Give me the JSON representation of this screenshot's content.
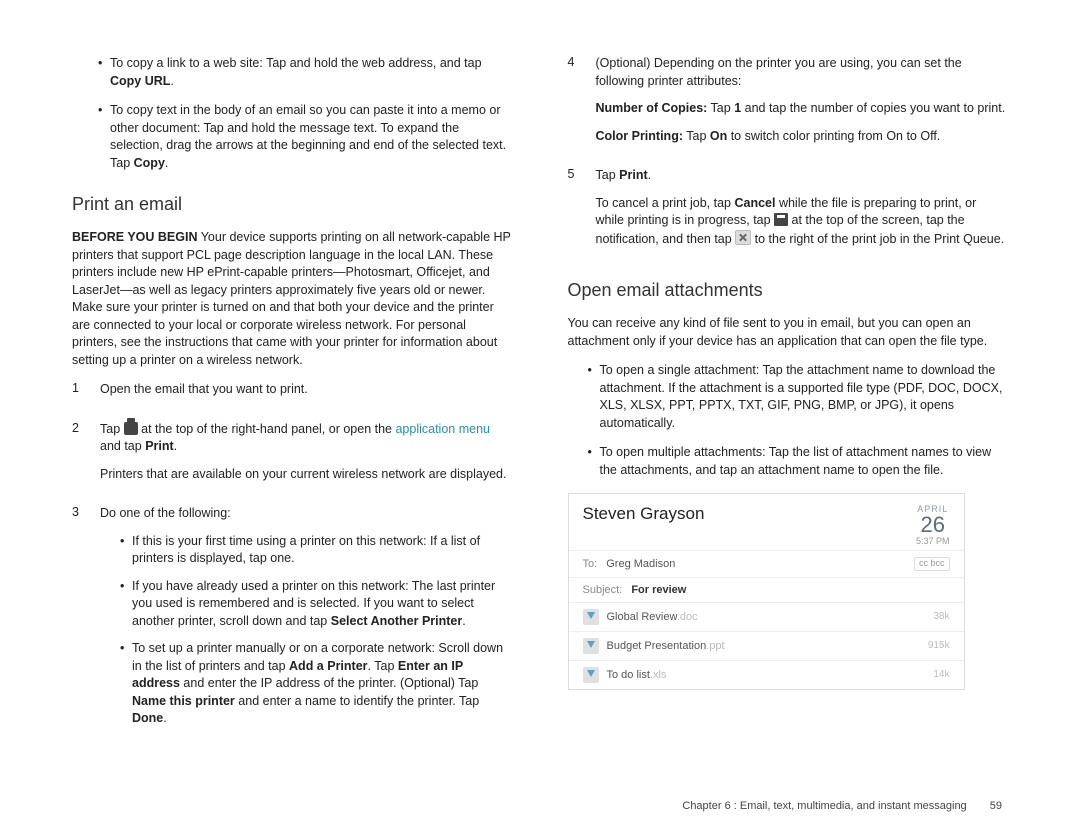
{
  "left": {
    "bullet1_a": "To copy a link to a web site: Tap and hold the web address, and tap ",
    "bullet1_b": "Copy URL",
    "bullet1_c": ".",
    "bullet2_a": "To copy text in the body of an email so you can paste it into a memo or other document: Tap and hold the message text. To expand the selection, drag the arrows at the beginning and end of the selected text. Tap ",
    "bullet2_b": "Copy",
    "bullet2_c": ".",
    "h_print": "Print an email",
    "before_label": "BEFORE YOU BEGIN",
    "before_text": "  Your device supports printing on all network-capable HP printers that support PCL page description language in the local LAN. These printers include new HP ePrint-capable printers—Photosmart, Officejet, and LaserJet—as well as legacy printers approximately five years old or newer. Make sure your printer is turned on and that both your device and the printer are connected to your local or corporate wireless network. For personal printers, see the instructions that came with your printer for information about setting up a printer on a wireless network.",
    "step1_n": "1",
    "step1": "Open the email that you want to print.",
    "step2_n": "2",
    "step2_a": "Tap ",
    "step2_b": " at the top of the right-hand panel, or open the ",
    "step2_link": "application menu",
    "step2_c": " and tap ",
    "step2_d": "Print",
    "step2_e": ".",
    "step2_note": "Printers that are available on your current wireless network are displayed.",
    "step3_n": "3",
    "step3": "Do one of the following:",
    "s3_b1": "If this is your first time using a printer on this network: If a list of printers is displayed, tap one.",
    "s3_b2_a": "If you have already used a printer on this network: The last printer you used is remembered and is selected. If you want to select another printer, scroll down and tap ",
    "s3_b2_b": "Select Another Printer",
    "s3_b2_c": ".",
    "s3_b3_a": "To set up a printer manually or on a corporate network: Scroll down in the list of printers and tap ",
    "s3_b3_b": "Add a Printer",
    "s3_b3_c": ". Tap ",
    "s3_b3_d": "Enter an IP address",
    "s3_b3_e": " and enter the IP address of the printer. (Optional) Tap ",
    "s3_b3_f": "Name this printer",
    "s3_b3_g": " and enter a name to identify the printer. Tap ",
    "s3_b3_h": "Done",
    "s3_b3_i": "."
  },
  "right": {
    "step4_n": "4",
    "step4": "(Optional) Depending on the printer you are using, you can set the following printer attributes:",
    "num_copies_a": "Number of Copies:",
    "num_copies_b": " Tap ",
    "num_copies_c": "1",
    "num_copies_d": " and tap the number of copies you want to print.",
    "color_a": "Color Printing:",
    "color_b": " Tap ",
    "color_c": "On",
    "color_d": " to switch color printing from On to Off.",
    "step5_n": "5",
    "step5_a": "Tap ",
    "step5_b": "Print",
    "step5_c": ".",
    "cancel_a": "To cancel a print job, tap ",
    "cancel_b": "Cancel",
    "cancel_c": " while the file is preparing to print, or while printing is in progress, tap ",
    "cancel_d": " at the top of the screen, tap the notification, and then tap ",
    "cancel_e": " to the right of the print job in the Print Queue.",
    "h_open": "Open email attachments",
    "open_intro": "You can receive any kind of file sent to you in email, but you can open an attachment only if your device has an application that can open the file type.",
    "ob1": "To open a single attachment: Tap the attachment name to download the attachment. If the attachment is a supported file type (PDF, DOC, DOCX, XLS, XLSX, PPT, PPTX, TXT, GIF, PNG, BMP, or JPG), it opens automatically.",
    "ob2": "To open multiple attachments: Tap the list of attachment names to view the attachments, and tap an attachment name to open the file."
  },
  "email": {
    "from": "Steven Grayson",
    "month": "APRIL",
    "day": "26",
    "time": "5:37 PM",
    "to_lbl": "To:",
    "to_val": "Greg Madison",
    "cc": "cc bcc",
    "subj_lbl": "Subject:",
    "subj_val": "For review",
    "att1_name": "Global Review",
    "att1_ext": ".doc",
    "att1_size": "38k",
    "att2_name": "Budget Presentation",
    "att2_ext": ".ppt",
    "att2_size": "915k",
    "att3_name": "To do list",
    "att3_ext": ".xls",
    "att3_size": "14k"
  },
  "footer": {
    "chapter": "Chapter 6 : Email, text, multimedia, and instant messaging",
    "page": "59"
  }
}
